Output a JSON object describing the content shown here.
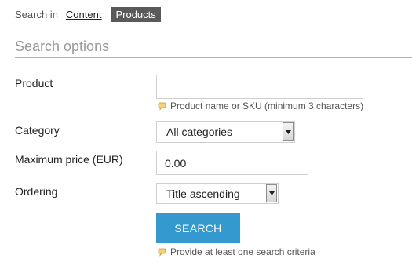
{
  "search_in": {
    "label": "Search in",
    "tabs": [
      {
        "label": "Content",
        "active": false
      },
      {
        "label": "Products",
        "active": true
      }
    ]
  },
  "section": {
    "title": "Search options"
  },
  "form": {
    "product": {
      "label": "Product",
      "value": "",
      "hint": "Product name or SKU (minimum 3 characters)"
    },
    "category": {
      "label": "Category",
      "selected": "All categories"
    },
    "max_price": {
      "label": "Maximum price (EUR)",
      "value": "0.00"
    },
    "ordering": {
      "label": "Ordering",
      "selected": "Title ascending"
    },
    "search_button": {
      "label": "SEARCH"
    },
    "footer_hint": "Provide at least one search criteria"
  },
  "colors": {
    "accent": "#3499cf",
    "active_tab": "#5a5a5a",
    "hint_icon": "#e8b84a"
  },
  "icons": {
    "hint": "speech-bubble-icon",
    "select_arrow": "triangle-down-icon"
  }
}
